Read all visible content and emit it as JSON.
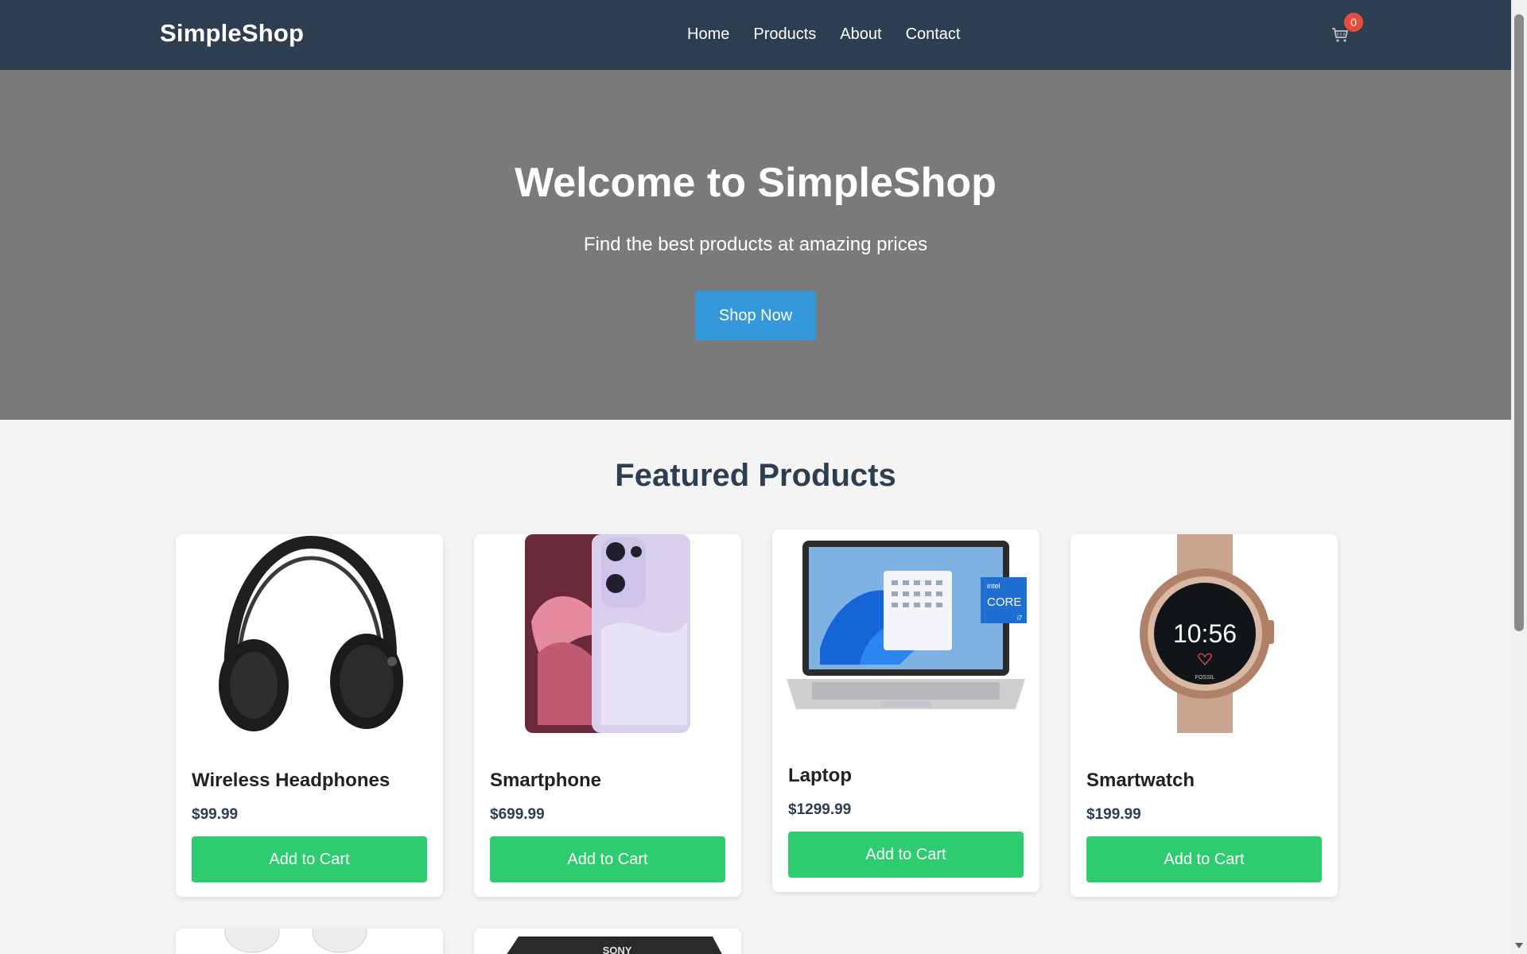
{
  "header": {
    "logo": "SimpleShop",
    "nav": [
      "Home",
      "Products",
      "About",
      "Contact"
    ],
    "cart_count": "0",
    "cart_icon": "cart-icon"
  },
  "hero": {
    "title": "Welcome to SimpleShop",
    "subtitle": "Find the best products at amazing prices",
    "cta": "Shop Now"
  },
  "featured": {
    "title": "Featured Products",
    "products": [
      {
        "name": "Wireless Headphones",
        "price": "$99.99",
        "button": "Add to Cart",
        "image_icon": "headphones-image"
      },
      {
        "name": "Smartphone",
        "price": "$699.99",
        "button": "Add to Cart",
        "image_icon": "smartphone-image"
      },
      {
        "name": "Laptop",
        "price": "$1299.99",
        "button": "Add to Cart",
        "image_icon": "laptop-image"
      },
      {
        "name": "Smartwatch",
        "price": "$199.99",
        "button": "Add to Cart",
        "image_icon": "smartwatch-image"
      }
    ],
    "partial_products": [
      {
        "image_icon": "earbuds-image"
      },
      {
        "image_icon": "camera-image",
        "brand_text": "SONY"
      }
    ]
  },
  "smartwatch_face": {
    "time": "10:56",
    "brand": "FOSSIL"
  },
  "laptop_badge": {
    "line1": "intel",
    "line2": "CORE",
    "line3": "i7"
  },
  "colors": {
    "header_bg": "#2c3e50",
    "hero_bg": "#7a7a7a",
    "primary_button": "#3498db",
    "add_button": "#2ecc71",
    "badge": "#e74c3c"
  }
}
